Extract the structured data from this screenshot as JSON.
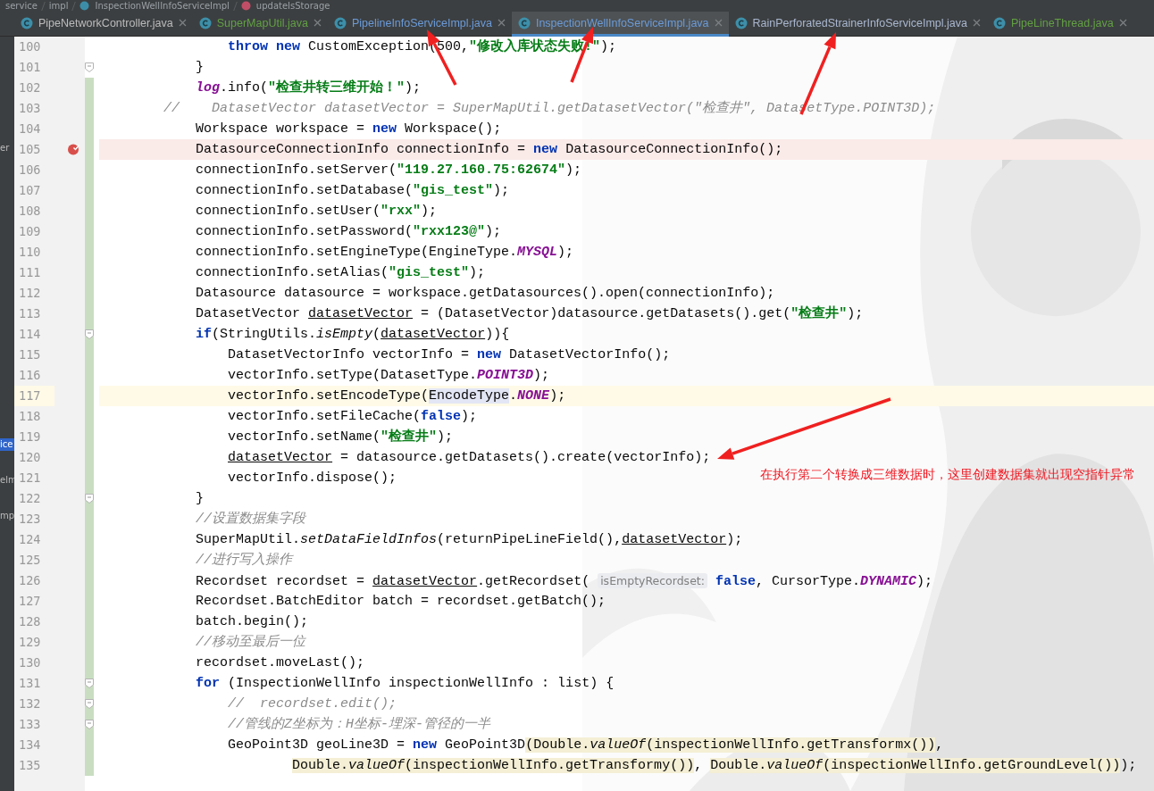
{
  "breadcrumb": [
    {
      "kind": "folder",
      "label": "service"
    },
    {
      "kind": "folder",
      "label": "impl"
    },
    {
      "kind": "class",
      "label": "InspectionWellInfoServiceImpl"
    },
    {
      "kind": "method",
      "label": "updateIsStorage"
    }
  ],
  "side_panel": {
    "fragments": [
      "er",
      "ice",
      "elm",
      "mp"
    ]
  },
  "tabs": [
    {
      "label": "PipeNetworkController.java",
      "color": "#bbbbbb",
      "selected": false
    },
    {
      "label": "SuperMapUtil.java",
      "color": "#62a043",
      "selected": false
    },
    {
      "label": "PipelineInfoServiceImpl.java",
      "color": "#6b9bd8",
      "selected": false
    },
    {
      "label": "InspectionWellInfoServiceImpl.java",
      "color": "#6b9bd8",
      "selected": true
    },
    {
      "label": "RainPerforatedStrainerInfoServiceImpl.java",
      "color": "#a9b7d0",
      "selected": false
    },
    {
      "label": "PipeLineThread.java",
      "color": "#62a043",
      "selected": false
    }
  ],
  "lines": [
    {
      "number": "100",
      "breakpoint": false,
      "current": false,
      "fold": false,
      "changed": false,
      "tokens": [
        {
          "kind": "keyword",
          "text": "                throw new"
        },
        {
          "kind": "plain",
          "text": " CustomException(500,"
        },
        {
          "kind": "string",
          "text": "\"修改入库状态失败!\""
        },
        {
          "kind": "plain",
          "text": ");"
        }
      ]
    },
    {
      "number": "101",
      "breakpoint": false,
      "current": false,
      "fold": true,
      "changed": false,
      "tokens": [
        {
          "kind": "plain",
          "text": "            }"
        }
      ]
    },
    {
      "number": "102",
      "breakpoint": false,
      "current": false,
      "fold": false,
      "changed": true,
      "tokens": [
        {
          "kind": "member",
          "text": "            log"
        },
        {
          "kind": "plain",
          "text": ".info("
        },
        {
          "kind": "string",
          "text": "\"检查井转三维开始！\""
        },
        {
          "kind": "plain",
          "text": ");"
        }
      ]
    },
    {
      "number": "103",
      "breakpoint": false,
      "current": false,
      "fold": false,
      "changed": true,
      "tokens": [
        {
          "kind": "comment",
          "text": "        //    DatasetVector datasetVector = SuperMapUtil.getDatasetVector(\"检查井\", DatasetType.POINT3D);"
        }
      ]
    },
    {
      "number": "104",
      "breakpoint": false,
      "current": false,
      "fold": false,
      "changed": true,
      "tokens": [
        {
          "kind": "plain",
          "text": "            Workspace workspace = "
        },
        {
          "kind": "keyword",
          "text": "new"
        },
        {
          "kind": "plain",
          "text": " Workspace();"
        }
      ]
    },
    {
      "number": "105",
      "breakpoint": true,
      "current": false,
      "fold": false,
      "changed": true,
      "tokens": [
        {
          "kind": "plain",
          "text": "            DatasourceConnectionInfo connectionInfo = "
        },
        {
          "kind": "keyword",
          "text": "new"
        },
        {
          "kind": "plain",
          "text": " DatasourceConnectionInfo();"
        }
      ]
    },
    {
      "number": "106",
      "breakpoint": false,
      "current": false,
      "fold": false,
      "changed": true,
      "tokens": [
        {
          "kind": "plain",
          "text": "            connectionInfo.setServer("
        },
        {
          "kind": "string",
          "text": "\"119.27.160.75:62674\""
        },
        {
          "kind": "plain",
          "text": ");"
        }
      ]
    },
    {
      "number": "107",
      "breakpoint": false,
      "current": false,
      "fold": false,
      "changed": true,
      "tokens": [
        {
          "kind": "plain",
          "text": "            connectionInfo.setDatabase("
        },
        {
          "kind": "string",
          "text": "\"gis_test\""
        },
        {
          "kind": "plain",
          "text": ");"
        }
      ]
    },
    {
      "number": "108",
      "breakpoint": false,
      "current": false,
      "fold": false,
      "changed": true,
      "tokens": [
        {
          "kind": "plain",
          "text": "            connectionInfo.setUser("
        },
        {
          "kind": "string",
          "text": "\"rxx\""
        },
        {
          "kind": "plain",
          "text": ");"
        }
      ]
    },
    {
      "number": "109",
      "breakpoint": false,
      "current": false,
      "fold": false,
      "changed": true,
      "tokens": [
        {
          "kind": "plain",
          "text": "            connectionInfo.setPassword("
        },
        {
          "kind": "string",
          "text": "\"rxx123@\""
        },
        {
          "kind": "plain",
          "text": ");"
        }
      ]
    },
    {
      "number": "110",
      "breakpoint": false,
      "current": false,
      "fold": false,
      "changed": true,
      "tokens": [
        {
          "kind": "plain",
          "text": "            connectionInfo.setEngineType(EngineType."
        },
        {
          "kind": "constant",
          "text": "MYSQL"
        },
        {
          "kind": "plain",
          "text": ");"
        }
      ]
    },
    {
      "number": "111",
      "breakpoint": false,
      "current": false,
      "fold": false,
      "changed": true,
      "tokens": [
        {
          "kind": "plain",
          "text": "            connectionInfo.setAlias("
        },
        {
          "kind": "string",
          "text": "\"gis_test\""
        },
        {
          "kind": "plain",
          "text": ");"
        }
      ]
    },
    {
      "number": "112",
      "breakpoint": false,
      "current": false,
      "fold": false,
      "changed": true,
      "tokens": [
        {
          "kind": "plain",
          "text": "            Datasource datasource = workspace.getDatasources().open(connectionInfo);"
        }
      ]
    },
    {
      "number": "113",
      "breakpoint": false,
      "current": false,
      "fold": false,
      "changed": true,
      "tokens": [
        {
          "kind": "plain",
          "text": "            DatasetVector "
        },
        {
          "kind": "underline",
          "text": "datasetVector"
        },
        {
          "kind": "plain",
          "text": " = (DatasetVector)datasource.getDatasets().get("
        },
        {
          "kind": "string",
          "text": "\"检查井\""
        },
        {
          "kind": "plain",
          "text": ");"
        }
      ]
    },
    {
      "number": "114",
      "breakpoint": false,
      "current": false,
      "fold": true,
      "changed": true,
      "tokens": [
        {
          "kind": "keyword",
          "text": "            if"
        },
        {
          "kind": "plain",
          "text": "(StringUtils."
        },
        {
          "kind": "italic",
          "text": "isEmpty"
        },
        {
          "kind": "plain",
          "text": "("
        },
        {
          "kind": "underline",
          "text": "datasetVector"
        },
        {
          "kind": "plain",
          "text": ")){"
        }
      ]
    },
    {
      "number": "115",
      "breakpoint": false,
      "current": false,
      "fold": false,
      "changed": true,
      "tokens": [
        {
          "kind": "plain",
          "text": "                DatasetVectorInfo vectorInfo = "
        },
        {
          "kind": "keyword",
          "text": "new"
        },
        {
          "kind": "plain",
          "text": " DatasetVectorInfo();"
        }
      ]
    },
    {
      "number": "116",
      "breakpoint": false,
      "current": false,
      "fold": false,
      "changed": true,
      "tokens": [
        {
          "kind": "plain",
          "text": "                vectorInfo.setType(DatasetType."
        },
        {
          "kind": "constant",
          "text": "POINT3D"
        },
        {
          "kind": "plain",
          "text": ");"
        }
      ]
    },
    {
      "number": "117",
      "breakpoint": false,
      "current": true,
      "fold": false,
      "changed": true,
      "tokens": [
        {
          "kind": "plain",
          "text": "                vectorInfo.setEncodeType("
        },
        {
          "kind": "match",
          "text": "EncodeType"
        },
        {
          "kind": "plain",
          "text": "."
        },
        {
          "kind": "constant",
          "text": "NONE"
        },
        {
          "kind": "plain",
          "text": ");"
        }
      ]
    },
    {
      "number": "118",
      "breakpoint": false,
      "current": false,
      "fold": false,
      "changed": true,
      "tokens": [
        {
          "kind": "plain",
          "text": "                vectorInfo.setFileCache("
        },
        {
          "kind": "keyword",
          "text": "false"
        },
        {
          "kind": "plain",
          "text": ");"
        }
      ]
    },
    {
      "number": "119",
      "breakpoint": false,
      "current": false,
      "fold": false,
      "changed": true,
      "tokens": [
        {
          "kind": "plain",
          "text": "                vectorInfo.setName("
        },
        {
          "kind": "string",
          "text": "\"检查井\""
        },
        {
          "kind": "plain",
          "text": ");"
        }
      ]
    },
    {
      "number": "120",
      "breakpoint": false,
      "current": false,
      "fold": false,
      "changed": true,
      "tokens": [
        {
          "kind": "underline",
          "text": "                datasetVector"
        },
        {
          "kind": "plain",
          "text": " = datasource.getDatasets().create(vectorInfo);"
        }
      ]
    },
    {
      "number": "121",
      "breakpoint": false,
      "current": false,
      "fold": false,
      "changed": true,
      "tokens": [
        {
          "kind": "plain",
          "text": "                vectorInfo.dispose();"
        }
      ]
    },
    {
      "number": "122",
      "breakpoint": false,
      "current": false,
      "fold": true,
      "changed": true,
      "tokens": [
        {
          "kind": "plain",
          "text": "            }"
        }
      ]
    },
    {
      "number": "123",
      "breakpoint": false,
      "current": false,
      "fold": false,
      "changed": true,
      "tokens": [
        {
          "kind": "comment",
          "text": "            //设置数据集字段"
        }
      ]
    },
    {
      "number": "124",
      "breakpoint": false,
      "current": false,
      "fold": false,
      "changed": true,
      "tokens": [
        {
          "kind": "plain",
          "text": "            SuperMapUtil."
        },
        {
          "kind": "italic",
          "text": "setDataFieldInfos"
        },
        {
          "kind": "plain",
          "text": "(returnPipeLineField(),"
        },
        {
          "kind": "underline",
          "text": "datasetVector"
        },
        {
          "kind": "plain",
          "text": ");"
        }
      ]
    },
    {
      "number": "125",
      "breakpoint": false,
      "current": false,
      "fold": false,
      "changed": true,
      "tokens": [
        {
          "kind": "comment",
          "text": "            //进行写入操作"
        }
      ]
    },
    {
      "number": "126",
      "breakpoint": false,
      "current": false,
      "fold": false,
      "changed": true,
      "tokens": [
        {
          "kind": "plain",
          "text": "            Recordset recordset = "
        },
        {
          "kind": "underline",
          "text": "datasetVector"
        },
        {
          "kind": "plain",
          "text": ".getRecordset( "
        },
        {
          "kind": "hint",
          "text": "isEmptyRecordset:"
        },
        {
          "kind": "keyword",
          "text": " false"
        },
        {
          "kind": "plain",
          "text": ", CursorType."
        },
        {
          "kind": "constant",
          "text": "DYNAMIC"
        },
        {
          "kind": "plain",
          "text": ");"
        }
      ]
    },
    {
      "number": "127",
      "breakpoint": false,
      "current": false,
      "fold": false,
      "changed": true,
      "tokens": [
        {
          "kind": "plain",
          "text": "            Recordset.BatchEditor batch = recordset.getBatch();"
        }
      ]
    },
    {
      "number": "128",
      "breakpoint": false,
      "current": false,
      "fold": false,
      "changed": true,
      "tokens": [
        {
          "kind": "plain",
          "text": "            batch.begin();"
        }
      ]
    },
    {
      "number": "129",
      "breakpoint": false,
      "current": false,
      "fold": false,
      "changed": true,
      "tokens": [
        {
          "kind": "comment",
          "text": "            //移动至最后一位"
        }
      ]
    },
    {
      "number": "130",
      "breakpoint": false,
      "current": false,
      "fold": false,
      "changed": true,
      "tokens": [
        {
          "kind": "plain",
          "text": "            recordset.moveLast();"
        }
      ]
    },
    {
      "number": "131",
      "breakpoint": false,
      "current": false,
      "fold": true,
      "changed": true,
      "tokens": [
        {
          "kind": "keyword",
          "text": "            for"
        },
        {
          "kind": "plain",
          "text": " (InspectionWellInfo inspectionWellInfo : list) {"
        }
      ]
    },
    {
      "number": "132",
      "breakpoint": false,
      "current": false,
      "fold": true,
      "changed": true,
      "tokens": [
        {
          "kind": "comment",
          "text": "                //  recordset.edit();"
        }
      ]
    },
    {
      "number": "133",
      "breakpoint": false,
      "current": false,
      "fold": true,
      "changed": true,
      "tokens": [
        {
          "kind": "comment",
          "text": "                //管线的Z坐标为：H坐标-埋深-管径的一半"
        }
      ]
    },
    {
      "number": "134",
      "breakpoint": false,
      "current": false,
      "fold": false,
      "changed": true,
      "tokens": [
        {
          "kind": "plain",
          "text": "                GeoPoint3D geoLine3D = "
        },
        {
          "kind": "keyword",
          "text": "new"
        },
        {
          "kind": "plain",
          "text": " GeoPoint3D"
        },
        {
          "kind": "argument",
          "text": "(Double."
        },
        {
          "kind": "argument-italic",
          "text": "valueOf"
        },
        {
          "kind": "argument",
          "text": "(inspectionWellInfo.getTransformx())"
        },
        {
          "kind": "plain",
          "text": ","
        }
      ]
    },
    {
      "number": "135",
      "breakpoint": false,
      "current": false,
      "fold": false,
      "changed": true,
      "tokens": [
        {
          "kind": "argument",
          "text": "                        Double."
        },
        {
          "kind": "argument-italic",
          "text": "valueOf"
        },
        {
          "kind": "argument",
          "text": "(inspectionWellInfo.getTransformy())"
        },
        {
          "kind": "plain",
          "text": ", "
        },
        {
          "kind": "argument",
          "text": "Double."
        },
        {
          "kind": "argument-italic",
          "text": "valueOf"
        },
        {
          "kind": "argument",
          "text": "(inspectionWellInfo.getGroundLevel())"
        },
        {
          "kind": "plain",
          "text": ");"
        }
      ]
    }
  ],
  "annotation": {
    "note": "在执行第二个转换成三维数据时，这里创建数据集就出现空指针异常"
  }
}
